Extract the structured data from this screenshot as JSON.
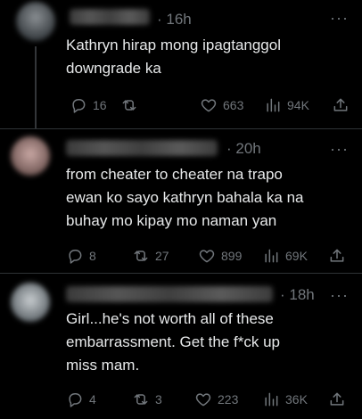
{
  "replies": [
    {
      "time": "· 16h",
      "text_lines": [
        "Kathryn hirap mong ipagtanggol",
        "downgrade ka"
      ],
      "stats": {
        "replies": "16",
        "reposts": "",
        "likes": "663",
        "views": "94K"
      }
    },
    {
      "time": "· 20h",
      "text_lines": [
        "from cheater to cheater na trapo",
        "ewan ko sayo kathryn bahala ka na",
        "buhay mo kipay mo naman yan"
      ],
      "stats": {
        "replies": "8",
        "reposts": "27",
        "likes": "899",
        "views": "69K"
      }
    },
    {
      "time": "· 18h",
      "text_lines": [
        "Girl...he's not worth all of these",
        "embarrassment. Get the f*ck up",
        "miss mam."
      ],
      "stats": {
        "replies": "4",
        "reposts": "3",
        "likes": "223",
        "views": "36K"
      }
    }
  ],
  "more_label": "···",
  "icons": {
    "reply": "reply-icon",
    "repost": "repost-icon",
    "like": "heart-icon",
    "views": "views-icon",
    "share": "share-icon"
  },
  "colors": {
    "background": "#000000",
    "text": "#e7e9ea",
    "muted": "#71767b",
    "divider": "#2f3336"
  }
}
